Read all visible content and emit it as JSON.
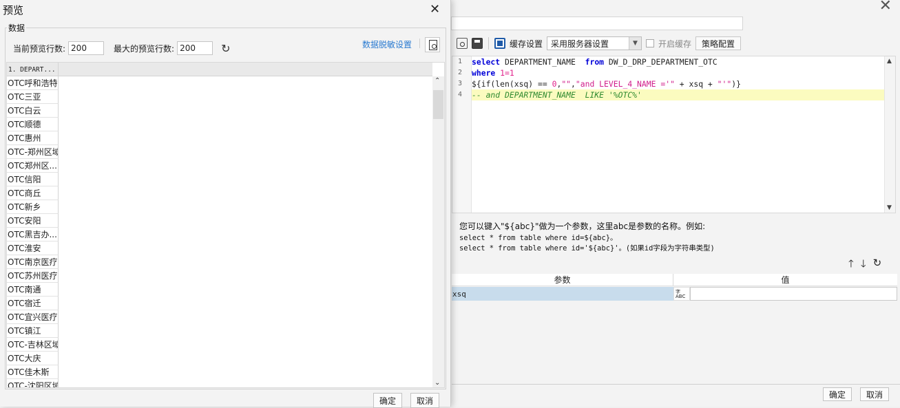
{
  "background_dialog": {
    "close_glyph": "✕",
    "toolbar": {
      "cache_label": "缓存设置",
      "cache_select_value": "采用服务器设置",
      "enable_cache_label": "开启缓存",
      "strategy_button": "策略配置"
    },
    "editor": {
      "line_numbers": [
        "1",
        "2",
        "3",
        "4"
      ]
    },
    "hint": {
      "line1": "您可以键入\"${abc}\"做为一个参数，这里abc是参数的名称。例如:",
      "line2": "select * from table where id=${abc}。",
      "line3": "select * from table where id='${abc}'。(如果id字段为字符串类型)"
    },
    "param_table": {
      "col_param": "参数",
      "col_value": "值",
      "rows": [
        {
          "name": "xsq",
          "type": "字\nABC",
          "value": ""
        }
      ]
    },
    "ok_button": "确定",
    "cancel_button": "取消"
  },
  "preview": {
    "title": "预览",
    "close_glyph": "✕",
    "group_title": "数据",
    "current_rows_label": "当前预览行数:",
    "current_rows_value": "200",
    "max_rows_label": "最大的预览行数:",
    "max_rows_value": "200",
    "desensitize_link": "数据脱敏设置",
    "grid_header": "1. DEPART...",
    "rows": [
      "OTC呼和浩特",
      "OTC三亚",
      "OTC白云",
      "OTC顺德",
      "OTC惠州",
      "OTC-郑州区域",
      "OTC郑州区...",
      "OTC信阳",
      "OTC商丘",
      "OTC新乡",
      "OTC安阳",
      "OTC黑吉办...",
      "OTC淮安",
      "OTC南京医疗",
      "OTC苏州医疗",
      "OTC南通",
      "OTC宿迁",
      "OTC宜兴医疗",
      "OTC镇江",
      "OTC-吉林区域",
      "OTC大庆",
      "OTC佳木斯",
      "OTC-沈阳区域"
    ],
    "ok_button": "确定",
    "cancel_button": "取消"
  }
}
